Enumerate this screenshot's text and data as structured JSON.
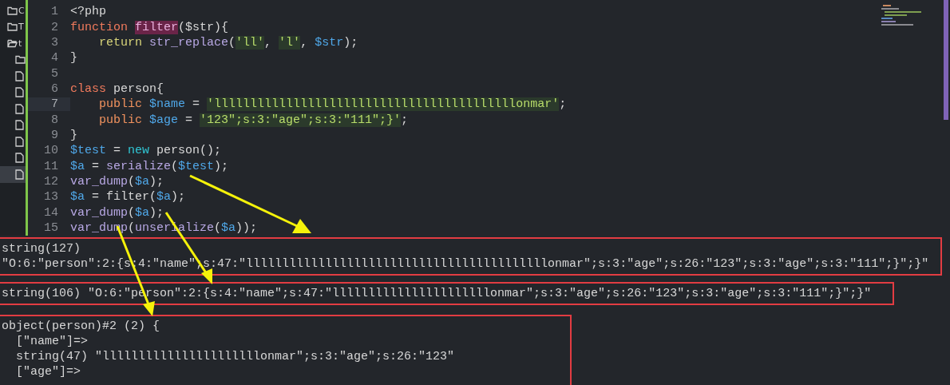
{
  "sidebar": {
    "items": [
      {
        "kind": "folder",
        "label": "C",
        "selected": false
      },
      {
        "kind": "folder",
        "label": "T",
        "selected": false
      },
      {
        "kind": "open-folder",
        "label": "t",
        "selected": false
      },
      {
        "kind": "folder",
        "selected": false
      },
      {
        "kind": "file",
        "selected": false
      },
      {
        "kind": "file",
        "selected": false
      },
      {
        "kind": "file",
        "selected": false
      },
      {
        "kind": "file",
        "selected": false
      },
      {
        "kind": "file",
        "selected": false
      },
      {
        "kind": "file",
        "selected": false
      },
      {
        "kind": "file",
        "selected": true
      }
    ]
  },
  "editor": {
    "lines": [
      {
        "number": "1",
        "current": false,
        "tokens": [
          {
            "kind": "plain",
            "text": "<?php"
          }
        ]
      },
      {
        "number": "2",
        "current": false,
        "tokens": [
          {
            "kind": "keyword",
            "text": "function "
          },
          {
            "kind": "match",
            "text": "filter"
          },
          {
            "kind": "plain",
            "text": "($str){"
          }
        ]
      },
      {
        "number": "3",
        "current": false,
        "tokens": [
          {
            "kind": "control",
            "text": "    return "
          },
          {
            "kind": "func",
            "text": "str_replace"
          },
          {
            "kind": "plain",
            "text": "("
          },
          {
            "kind": "string",
            "text": "'ll'"
          },
          {
            "kind": "plain",
            "text": ", "
          },
          {
            "kind": "string",
            "text": "'l'"
          },
          {
            "kind": "plain",
            "text": ", "
          },
          {
            "kind": "variable",
            "text": "$str"
          },
          {
            "kind": "plain",
            "text": ");"
          }
        ]
      },
      {
        "number": "4",
        "current": false,
        "tokens": [
          {
            "kind": "plain",
            "text": "}"
          }
        ]
      },
      {
        "number": "5",
        "current": false
      },
      {
        "number": "6",
        "current": false,
        "tokens": [
          {
            "kind": "keyword",
            "text": "class"
          },
          {
            "kind": "plain",
            "text": " person{"
          }
        ]
      },
      {
        "number": "7",
        "current": true,
        "tokens": [
          {
            "kind": "modifier",
            "text": "    public "
          },
          {
            "kind": "variable",
            "text": "$name"
          },
          {
            "kind": "plain",
            "text": " = "
          },
          {
            "kind": "string",
            "text": "'llllllllllllllllllllllllllllllllllllllllllonmar'"
          },
          {
            "kind": "plain",
            "text": ";"
          }
        ]
      },
      {
        "number": "8",
        "current": false,
        "tokens": [
          {
            "kind": "modifier",
            "text": "    public "
          },
          {
            "kind": "variable",
            "text": "$age"
          },
          {
            "kind": "plain",
            "text": " = "
          },
          {
            "kind": "string",
            "text": "'123\";s:3:\"age\";s:3:\"111\";}'"
          },
          {
            "kind": "plain",
            "text": ";"
          }
        ]
      },
      {
        "number": "9",
        "current": false,
        "tokens": [
          {
            "kind": "plain",
            "text": "}"
          }
        ]
      },
      {
        "number": "10",
        "current": false,
        "tokens": [
          {
            "kind": "variable",
            "text": "$test"
          },
          {
            "kind": "plain",
            "text": " = "
          },
          {
            "kind": "new",
            "text": "new"
          },
          {
            "kind": "plain",
            "text": " person();"
          }
        ]
      },
      {
        "number": "11",
        "current": false,
        "tokens": [
          {
            "kind": "variable",
            "text": "$a"
          },
          {
            "kind": "plain",
            "text": " = "
          },
          {
            "kind": "func",
            "text": "serialize"
          },
          {
            "kind": "plain",
            "text": "("
          },
          {
            "kind": "variable",
            "text": "$test"
          },
          {
            "kind": "plain",
            "text": ");"
          }
        ]
      },
      {
        "number": "12",
        "current": false,
        "tokens": [
          {
            "kind": "func",
            "text": "var_dump"
          },
          {
            "kind": "plain",
            "text": "("
          },
          {
            "kind": "variable",
            "text": "$a"
          },
          {
            "kind": "plain",
            "text": ");"
          }
        ]
      },
      {
        "number": "13",
        "current": false,
        "tokens": [
          {
            "kind": "variable",
            "text": "$a"
          },
          {
            "kind": "plain",
            "text": " = filter("
          },
          {
            "kind": "variable",
            "text": "$a"
          },
          {
            "kind": "plain",
            "text": ");"
          }
        ]
      },
      {
        "number": "14",
        "current": false,
        "tokens": [
          {
            "kind": "func",
            "text": "var_dump"
          },
          {
            "kind": "plain",
            "text": "("
          },
          {
            "kind": "variable",
            "text": "$a"
          },
          {
            "kind": "plain",
            "text": ");"
          }
        ]
      },
      {
        "number": "15",
        "current": false,
        "tokens": [
          {
            "kind": "func",
            "text": "var_dump"
          },
          {
            "kind": "plain",
            "text": "("
          },
          {
            "kind": "func",
            "text": "unserialize"
          },
          {
            "kind": "plain",
            "text": "("
          },
          {
            "kind": "variable",
            "text": "$a"
          },
          {
            "kind": "plain",
            "text": "));"
          }
        ]
      }
    ]
  },
  "output": {
    "blocks": [
      {
        "lines": [
          "string(127)",
          "\"O:6:\"person\":2:{s:4:\"name\";s:47:\"llllllllllllllllllllllllllllllllllllllllllonmar\";s:3:\"age\";s:26:\"123\";s:3:\"age\";s:3:\"111\";}\";}\""
        ]
      },
      {
        "lines": [
          "string(106) \"O:6:\"person\":2:{s:4:\"name\";s:47:\"llllllllllllllllllllllonmar\";s:3:\"age\";s:26:\"123\";s:3:\"age\";s:3:\"111\";}\";}\""
        ]
      },
      {
        "lines": [
          "object(person)#2 (2) {",
          "  [\"name\"]=>",
          "  string(47) \"llllllllllllllllllllllonmar\";s:3:\"age\";s:26:\"123\"",
          "  [\"age\"]=>"
        ]
      }
    ]
  }
}
